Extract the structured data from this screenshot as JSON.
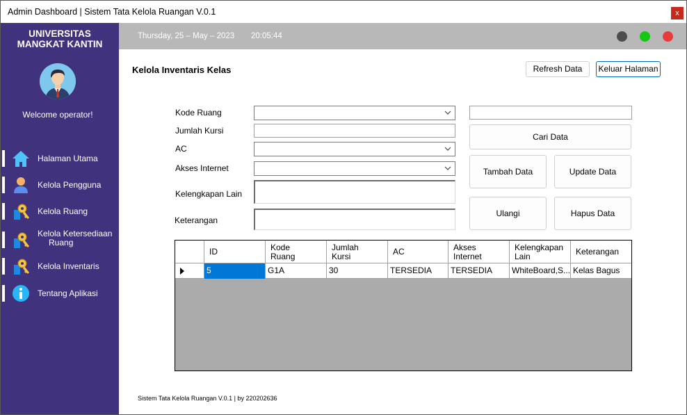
{
  "window": {
    "title": "Admin Dashboard | Sistem Tata Kelola Ruangan V.0.1",
    "close_label": "x"
  },
  "sidebar": {
    "brand_line1": "UNIVERSITAS",
    "brand_line2": "MANGKAT KANTIN",
    "welcome": "Welcome operator!",
    "items": [
      {
        "label": "Halaman Utama",
        "icon": "home-icon"
      },
      {
        "label": "Kelola Pengguna",
        "icon": "user-icon"
      },
      {
        "label": "Kelola Ruang",
        "icon": "key-icon"
      },
      {
        "label_line1": "Kelola Ketersediaan",
        "label_line2": "Ruang",
        "icon": "key-icon"
      },
      {
        "label": "Kelola Inventaris",
        "icon": "key-icon"
      },
      {
        "label": "Tentang Aplikasi",
        "icon": "info-icon"
      }
    ]
  },
  "topbar": {
    "date": "Thursday, 25 – May – 2023",
    "time": "20:05:44",
    "dots": [
      "#4d4d4d",
      "#14c814",
      "#e83c3c"
    ]
  },
  "main": {
    "title": "Kelola Inventaris Kelas",
    "refresh_label": "Refresh Data",
    "exit_label": "Keluar Halaman"
  },
  "form": {
    "kode_ruang_label": "Kode Ruang",
    "kode_ruang_value": "",
    "jumlah_kursi_label": "Jumlah Kursi",
    "jumlah_kursi_value": "",
    "ac_label": "AC",
    "ac_value": "",
    "akses_label": "Akses Internet",
    "akses_value": "",
    "kelengkapan_label": "Kelengkapan Lain",
    "kelengkapan_value": "",
    "keterangan_label": "Keterangan",
    "keterangan_value": "",
    "search_value": ""
  },
  "actions": {
    "cari": "Cari Data",
    "tambah": "Tambah Data",
    "update": "Update Data",
    "ulangi": "Ulangi",
    "hapus": "Hapus Data"
  },
  "table": {
    "columns": [
      [
        "ID"
      ],
      [
        "Kode",
        "Ruang"
      ],
      [
        "Jumlah",
        "Kursi"
      ],
      [
        "AC"
      ],
      [
        "Akses",
        "Internet"
      ],
      [
        "Kelengkapan",
        "Lain"
      ],
      [
        "Keterangan"
      ]
    ],
    "rows": [
      [
        "5",
        "G1A",
        "30",
        "TERSEDIA",
        "TERSEDIA",
        "WhiteBoard,S...",
        "Kelas Bagus"
      ]
    ]
  },
  "footer": "Sistem Tata Kelola Ruangan V.0.1 | by 220202636"
}
